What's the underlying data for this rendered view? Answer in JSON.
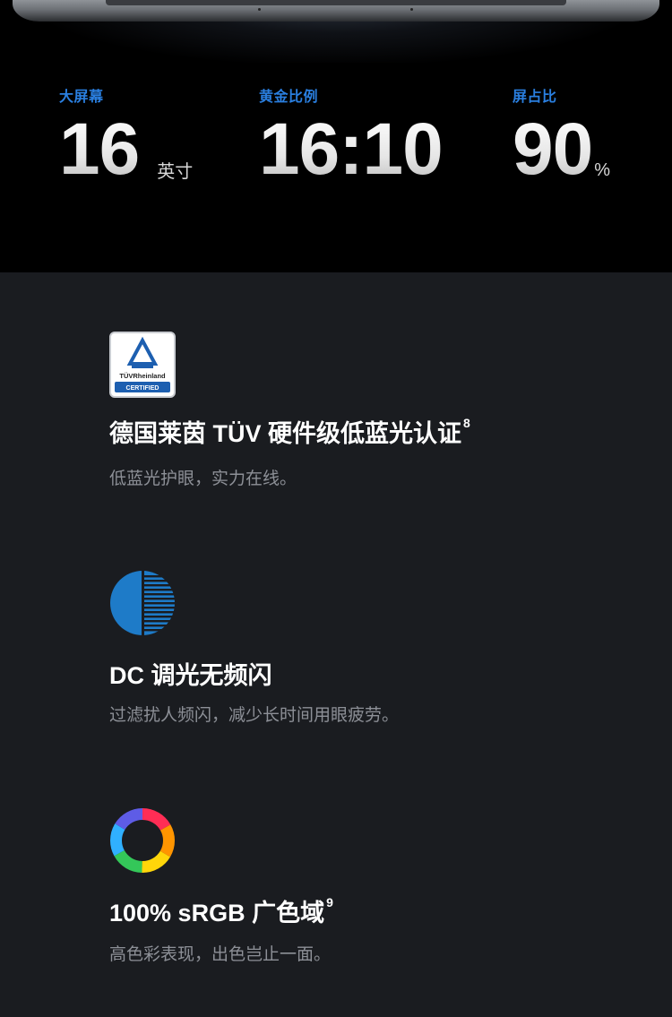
{
  "hero": {
    "stats": [
      {
        "label": "大屏幕",
        "value": "16",
        "unit": "英寸"
      },
      {
        "label": "黄金比例",
        "value": "16:10",
        "unit": ""
      },
      {
        "label": "屏占比",
        "value": "90",
        "unit": "%"
      }
    ]
  },
  "features": [
    {
      "icon": "tuv-rheinland-certified-icon",
      "title": "德国莱茵 TÜV 硬件级低蓝光认证",
      "footnote": "8",
      "desc": "低蓝光护眼，实力在线。"
    },
    {
      "icon": "dc-dimming-icon",
      "title": "DC 调光无频闪",
      "footnote": "",
      "desc": "过滤扰人频闪，减少长时间用眼疲劳。"
    },
    {
      "icon": "color-gamut-ring-icon",
      "title": "100% sRGB 广色域",
      "footnote": "9",
      "desc": "高色彩表现，出色岂止一面。"
    }
  ],
  "colors": {
    "accent_blue": "#2a7fe0",
    "section_bg": "#1a1c20",
    "desc_gray": "#8d9097",
    "icon_blue": "#1e7bc8"
  },
  "tuv_logo": {
    "line1": "TÜVRheinland",
    "line2": "CERTIFIED"
  }
}
